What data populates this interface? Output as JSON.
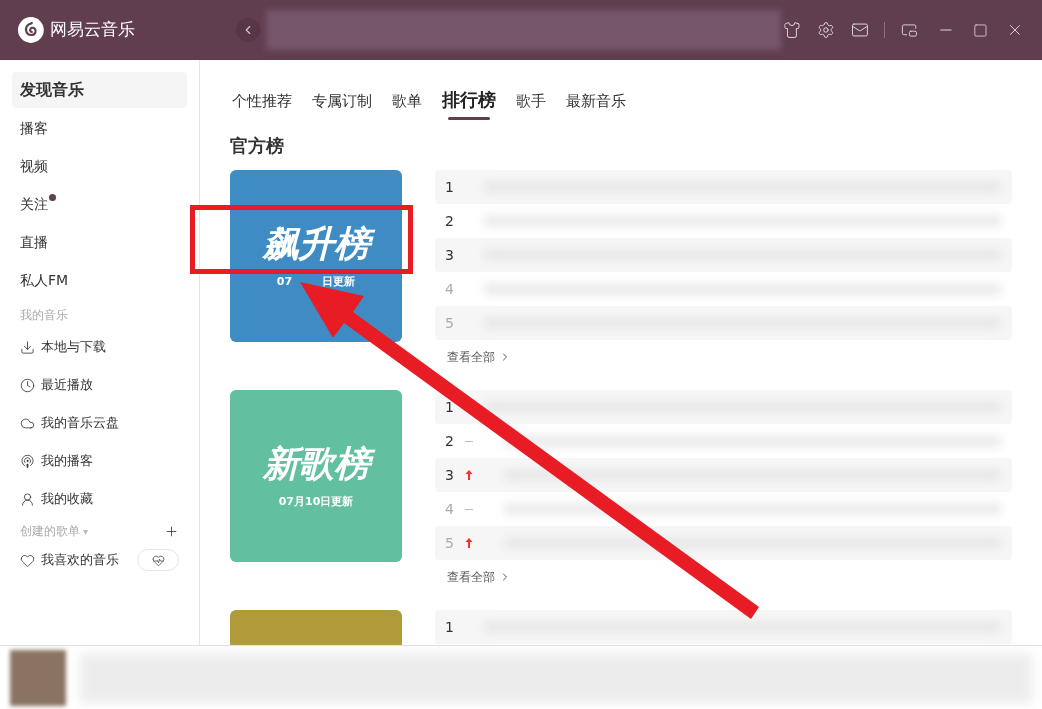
{
  "app": {
    "name": "网易云音乐"
  },
  "sidebar": {
    "items": [
      {
        "label": "发现音乐",
        "selected": true,
        "dot": false
      },
      {
        "label": "播客",
        "selected": false,
        "dot": false
      },
      {
        "label": "视频",
        "selected": false,
        "dot": false
      },
      {
        "label": "关注",
        "selected": false,
        "dot": true
      },
      {
        "label": "直播",
        "selected": false,
        "dot": false
      },
      {
        "label": "私人FM",
        "selected": false,
        "dot": false
      }
    ],
    "my_music_heading": "我的音乐",
    "my_music": [
      {
        "label": "本地与下载",
        "kind": "download"
      },
      {
        "label": "最近播放",
        "kind": "recent"
      },
      {
        "label": "我的音乐云盘",
        "kind": "cloud"
      },
      {
        "label": "我的播客",
        "kind": "podcast"
      },
      {
        "label": "我的收藏",
        "kind": "collection"
      }
    ],
    "created_heading": "创建的歌单",
    "created_heading_caret": "▾",
    "playlists": [
      {
        "label": "我喜欢的音乐"
      }
    ]
  },
  "tabs": [
    {
      "label": "个性推荐",
      "selected": false
    },
    {
      "label": "专属订制",
      "selected": false
    },
    {
      "label": "歌单",
      "selected": false
    },
    {
      "label": "排行榜",
      "selected": true
    },
    {
      "label": "歌手",
      "selected": false
    },
    {
      "label": "最新音乐",
      "selected": false
    }
  ],
  "section_title": "官方榜",
  "charts": [
    {
      "cover_title": "飙升榜",
      "cover_date_parts": [
        "07",
        "日更新"
      ],
      "color": "#3f8cc4",
      "view_all": "查看全部",
      "rows": [
        {
          "rank": "1",
          "top": true,
          "kind": "plain"
        },
        {
          "rank": "2",
          "top": true,
          "kind": "plain"
        },
        {
          "rank": "3",
          "top": true,
          "kind": "plain"
        },
        {
          "rank": "4",
          "top": false,
          "kind": "plain"
        },
        {
          "rank": "5",
          "top": false,
          "kind": "plain"
        }
      ]
    },
    {
      "cover_title": "新歌榜",
      "cover_date_parts": [
        "07月10日更新"
      ],
      "color": "#62bfa0",
      "view_all": "查看全部",
      "rows": [
        {
          "rank": "1",
          "top": true,
          "kind": "plain"
        },
        {
          "rank": "2",
          "top": true,
          "kind": "steady"
        },
        {
          "rank": "3",
          "top": true,
          "kind": "rising"
        },
        {
          "rank": "4",
          "top": false,
          "kind": "steady"
        },
        {
          "rank": "5",
          "top": false,
          "kind": "rising"
        }
      ]
    },
    {
      "color": "#b09a3a",
      "rows": [
        {
          "rank": "1",
          "top": true,
          "kind": "plain"
        }
      ]
    }
  ]
}
